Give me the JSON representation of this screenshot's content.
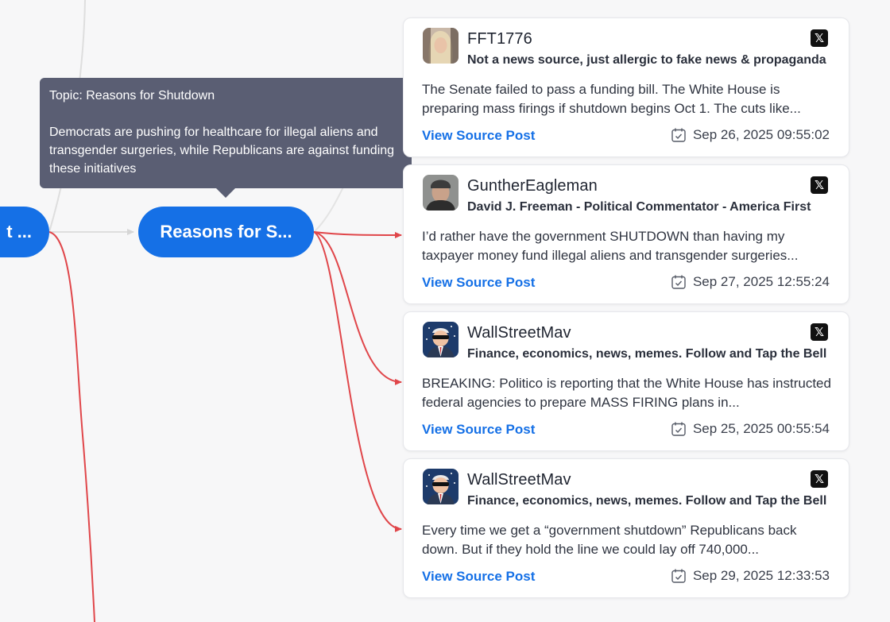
{
  "nodes": {
    "left_label": "t ...",
    "main_label": "Reasons for S..."
  },
  "tooltip": {
    "title": "Topic: Reasons for Shutdown",
    "body": "Democrats are pushing for healthcare for illegal aliens and transgender surgeries, while Republicans are against funding these initiatives"
  },
  "colors": {
    "accent": "#1570e6",
    "edge_red": "#e0464a",
    "edge_gray": "#dedede",
    "tooltip_bg": "#5a5e73"
  },
  "icons": {
    "platform": "x-logo-icon",
    "date": "calendar-icon"
  },
  "cards": [
    {
      "handle": "FFT1776",
      "bio": "Not a news source, just allergic to fake news & propaganda",
      "text": "The Senate failed to pass a funding bill. The White House is preparing mass firings if shutdown begins Oct 1. The cuts like...",
      "link": "View Source Post",
      "date": "Sep 26, 2025 09:55:02",
      "platform_glyph": "𝕏",
      "avatar": "woman-portrait"
    },
    {
      "handle": "GuntherEagleman",
      "bio": "David J. Freeman - Political Commentator - America First",
      "text": "I’d rather have the government SHUTDOWN than having my taxpayer money fund illegal aliens and transgender surgeries...",
      "link": "View Source Post",
      "date": "Sep 27, 2025 12:55:24",
      "platform_glyph": "𝕏",
      "avatar": "man-portrait"
    },
    {
      "handle": "WallStreetMav",
      "bio": "Finance, economics, news, memes. Follow and Tap the Bell",
      "text": "BREAKING: Politico is reporting that the White House has instructed federal agencies to prepare MASS FIRING plans in...",
      "link": "View Source Post",
      "date": "Sep 25, 2025 00:55:54",
      "platform_glyph": "𝕏",
      "avatar": "cartoon-suit-sunglasses"
    },
    {
      "handle": "WallStreetMav",
      "bio": "Finance, economics, news, memes. Follow and Tap the Bell",
      "text": "Every time we get a “government shutdown” Republicans back down. But if they hold the line we could lay off 740,000...",
      "link": "View Source Post",
      "date": "Sep 29, 2025 12:33:53",
      "platform_glyph": "𝕏",
      "avatar": "cartoon-suit-sunglasses"
    }
  ]
}
